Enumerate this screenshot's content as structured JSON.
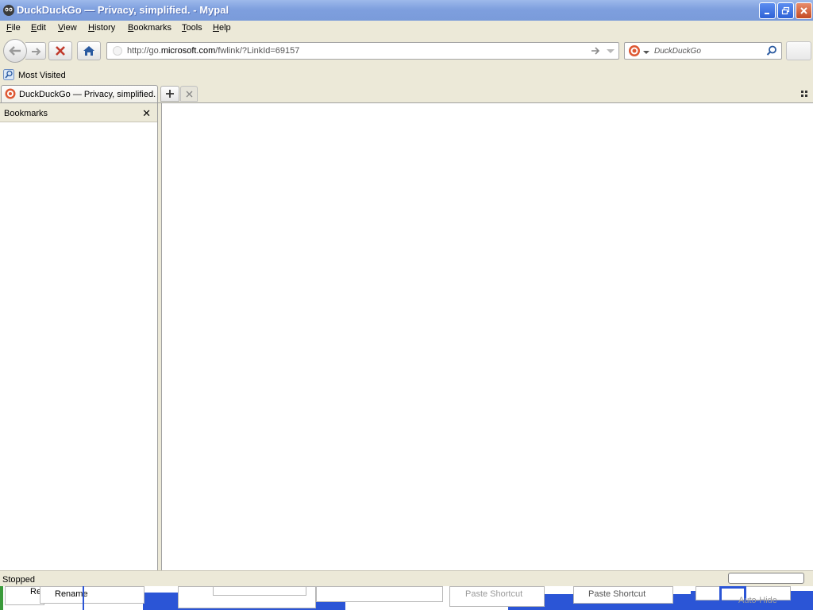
{
  "window": {
    "title": "DuckDuckGo — Privacy, simplified. - Mypal"
  },
  "menu": [
    "File",
    "Edit",
    "View",
    "History",
    "Bookmarks",
    "Tools",
    "Help"
  ],
  "navbar": {
    "url_prefix": "http://go.",
    "url_domain": "microsoft.com",
    "url_suffix": "/fwlink/?LinkId=69157",
    "search_placeholder": "DuckDuckGo"
  },
  "bookmarks_toolbar": {
    "most_visited": "Most Visited"
  },
  "tabs": [
    {
      "label": "DuckDuckGo — Privacy, simplified."
    }
  ],
  "sidebar": {
    "title": "Bookmarks"
  },
  "status": {
    "text": "Stopped"
  },
  "overlay_menu": {
    "rename": "Rename",
    "rename_partial": "Re",
    "paste_shortcut": "Paste Shortcut",
    "paste_shortcut_faint": "Paste Shortcut",
    "auto_hide": "Auto-Hide"
  },
  "colors": {
    "titlebar": "#7A9BDA",
    "chrome": "#ECE9D8",
    "taskbar_blue": "#2B55D6",
    "close_red": "#C44A23"
  }
}
